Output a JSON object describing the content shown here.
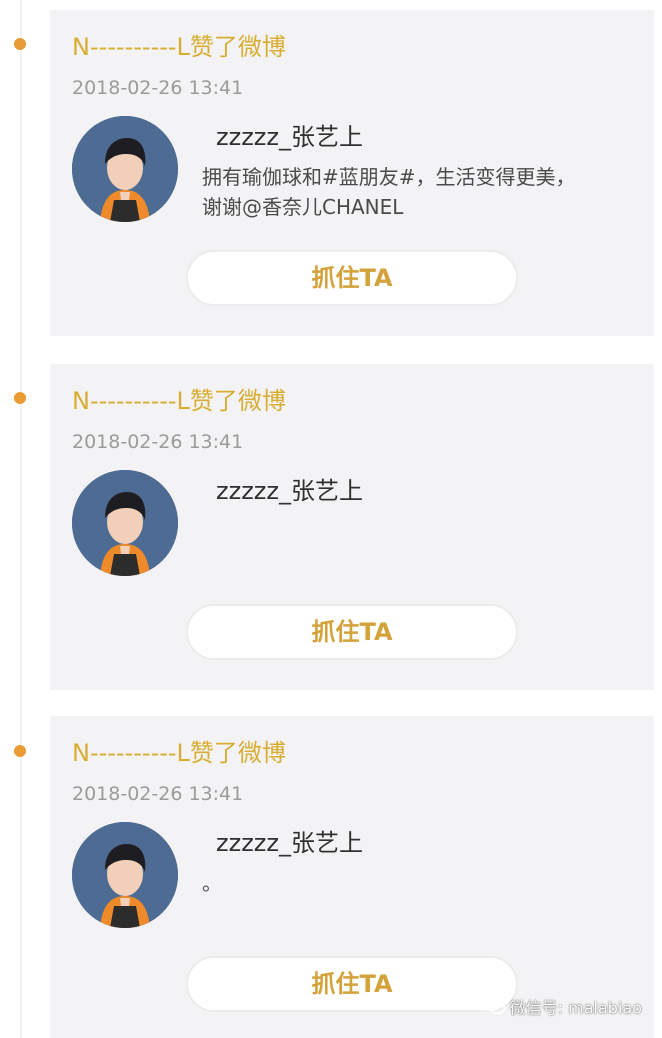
{
  "colors": {
    "accent_orange": "#eb9b34",
    "title_gold": "#d9ad33",
    "button_text": "#d4a23a",
    "card_bg": "#f3f3f5"
  },
  "posts": [
    {
      "title": "N----------L赞了微博",
      "time": "2018-02-26 13:41",
      "username": "zzzzz_张艺上",
      "content": "拥有瑜伽球和#蓝朋友#，生活变得更美，\n谢谢@香奈儿CHANEL",
      "button_label": "抓住TA",
      "avatar_icon": "avatar-photo"
    },
    {
      "title": "N----------L赞了微博",
      "time": "2018-02-26 13:41",
      "username": "zzzzz_张艺上",
      "content": "",
      "button_label": "抓住TA",
      "avatar_icon": "avatar-photo"
    },
    {
      "title": "N----------L赞了微博",
      "time": "2018-02-26 13:41",
      "username": "zzzzz_张艺上",
      "content": "。",
      "button_label": "抓住TA",
      "avatar_icon": "avatar-photo"
    }
  ],
  "watermark": {
    "icon": "wechat-icon",
    "text": "微信号: malabiao"
  }
}
